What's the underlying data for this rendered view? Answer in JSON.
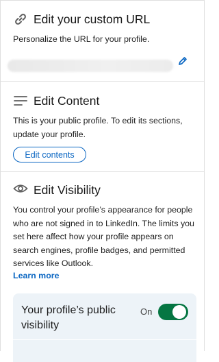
{
  "url_section": {
    "title": "Edit your custom URL",
    "description": "Personalize the URL for your profile.",
    "icons": {
      "title": "link-icon",
      "edit": "pencil-icon"
    }
  },
  "content_section": {
    "title": "Edit Content",
    "description": "This is your public profile. To edit its sections, update your profile.",
    "button_label": "Edit contents",
    "icons": {
      "title": "lines-icon"
    }
  },
  "visibility_section": {
    "title": "Edit Visibility",
    "description": "You control your profile’s appearance for people who are not signed in to LinkedIn. The limits you set here affect how your profile appears on search engines, profile badges, and permitted services like Outlook.",
    "learn_more": "Learn more",
    "public_visibility": {
      "label": "Your profile’s public visibility",
      "state": "On",
      "enabled": true
    },
    "icons": {
      "title": "eye-icon"
    }
  },
  "colors": {
    "accent": "#0a66c2",
    "toggle_on": "#057642",
    "card_bg": "#edf3f8",
    "divider": "#e0e0e0"
  }
}
